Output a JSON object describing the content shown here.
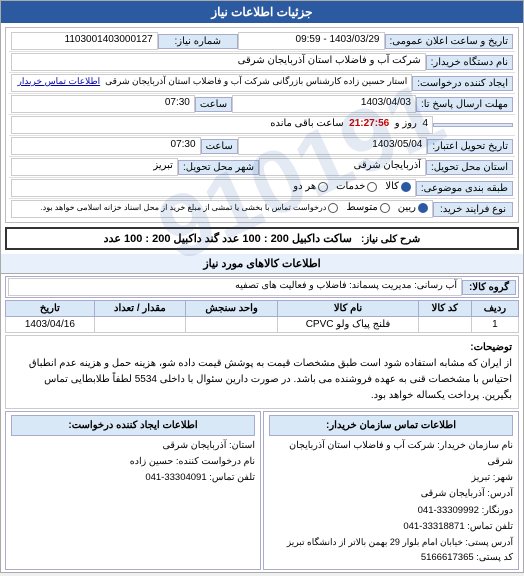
{
  "header": {
    "title": "جزئيات اطلاعات نياز"
  },
  "top_info": {
    "shomara_niyaz_label": "شماره نیاز:",
    "shomara_niyaz_value": "1103001403000127",
    "tarikh_label": "تاریخ و ساعت اعلان عمومی:",
    "tarikh_value": "1403/03/29 - 09:59",
    "foreshandeh_label": "نام دستگاه خریدار:",
    "foreshandeh_value": "شرکت آب و فاضلاب استان آذربایجان شرقی",
    "place_label": "ایجاد کننده درخواست:",
    "place_value": "استار حسین زاده کارشناس بازرگانی شرکت آب و فاضلاب استان آذربایجان شرقی",
    "contact_link": "اطلاعات تماس خریدار",
    "mohlat_label": "مهلت ارسال پاسخ تا:",
    "mohlat_date": "1403/04/03",
    "mohlat_time": "07:30",
    "mohlat_row2": "4",
    "mohlat_day_label": "روز و",
    "mohlat_remaining": "21:27:56",
    "mohlat_remaining_label": "ساعت باقی مانده",
    "deadline_label": "تاریخ تحویل اعتبار:",
    "deadline_date": "1403/05/04",
    "deadline_time": "07:30",
    "ostan_label": "استان محل تحویل:",
    "ostan_value": "آذربایجان شرقی",
    "shahr_label": "شهر محل تحویل:",
    "shahr_value": "تبریز",
    "tabaghe_label": "طبقه بندی موضوعی:",
    "tabaghe_options": [
      "کالا",
      "خدمات",
      "هر دو"
    ],
    "tabaghe_selected": "کالا",
    "nooe_label": "نوع فرایند خرید:",
    "nooe_options": [
      "ریین",
      "متوسط",
      "درخواست تماس با بخشی یا تمشی از مبلغ خریداز محل اسناد خزانه اسلامی خواهد بود"
    ],
    "nooe_selected": "ریین"
  },
  "sharh_kalay": {
    "label": "شرح کلی نیاز:",
    "value": "ساکت داکبیل 200 : 100 عدد گند داکبیل 200 : 100 عدد"
  },
  "ettelaat_kalay": {
    "label": "اطلاعات کالاهای مورد نیاز"
  },
  "group_row": {
    "label": "گروه کالا:",
    "value": "آب رسانی: مدیریت پسماند: فاضلاب و فعالیت های تصفیه"
  },
  "table": {
    "headers": [
      "ردیف",
      "کد کالا",
      "نام کالا",
      "واحد سنجش",
      "مقدار / تعداد",
      "تاریخ"
    ],
    "rows": [
      [
        "1",
        "",
        "فلنج پیاک ولو CPVC",
        "",
        "",
        "1403/04/16"
      ]
    ]
  },
  "note": {
    "label": "توضیحات:",
    "text": "از ایران که مشابه استفاده شود است طبق مشخصات قیمت به پوشش قیمت داده شو، هزینه حمل و هزینه عدم انطباق احتیاس با مشخصات قنی به عهده فروشنده می باشد. در صورت دارین سئوال با داخلی 5534 لطفاً طلابطایی تماس بگیرین. پرداخت یکساله خواهد بود."
  },
  "contacts": {
    "buyer_title": "اطلاعات تماس سازمان خریدار:",
    "buyer_org": "نام سازمان خریدار: شرکت آب و فاضلاب استان آذربایجان شرقی",
    "buyer_city": "شهر: تبریز",
    "buyer_address": "آدرس: آذربایجان شرقی",
    "buyer_phone": "دورنگار: 33309992-041",
    "buyer_tel": "تلفن تماس: 33318871-041",
    "buyer_postal": "آدرس پستی: خیابان امام بلوار 29 بهمن بالاتر از دانشگاه تبریز",
    "buyer_code": "کد پستی: 5166617365",
    "requester_title": "اطلاعات ایجاد کننده درخواست:",
    "requester_org": "استان: آذربایجان شرقی",
    "requester_name": "نام درخواست کننده: حسین زاده",
    "requester_tel": "تلفن تماس: 33304091-041"
  }
}
